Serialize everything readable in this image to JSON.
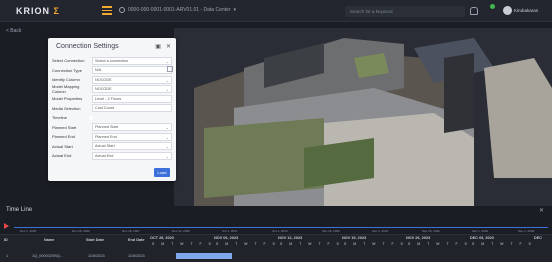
{
  "header": {
    "logo_text": "KRION",
    "logo_accent": "Σ",
    "breadcrumb": "0000-000-0001-0001-ARV01.01 - Data Center",
    "search_placeholder": "Search for a keyword",
    "username": "Kirubakaran"
  },
  "nav": {
    "back_label": "< Back"
  },
  "connection_settings": {
    "title": "Connection Settings",
    "rows": [
      {
        "label": "Select Connection",
        "value": "Select a connection"
      },
      {
        "label": "Connection Type",
        "value": "N/A"
      },
      {
        "label": "Identity Column",
        "value": "NOCODE"
      },
      {
        "label": "Model Mapping Column",
        "value": "NOCODE"
      },
      {
        "label": "Model Properties",
        "value": "Level - 2 Floors"
      },
      {
        "label": "Media Selection",
        "value": "Cost Count"
      },
      {
        "label": "Timeline",
        "value": ""
      },
      {
        "label": "Planned Start",
        "value": "Planned Start"
      },
      {
        "label": "Planned End",
        "value": "Planned End"
      },
      {
        "label": "Actual Start",
        "value": "Actual Start"
      },
      {
        "label": "Actual End",
        "value": "Actual End"
      }
    ],
    "load_label": "Load"
  },
  "timeline": {
    "title": "Time Line",
    "scale_labels": [
      "Dec 1, 2025",
      "Dec 29, 2026",
      "Dec 18, 2027",
      "Dec 12, 2030",
      "Oct 1, 2011",
      "Oct 1, 2030",
      "Sep 16, 2030",
      "Sep 1, 2031",
      "Sep 16, 2030",
      "Sep 1, 2030",
      "Sep 1, 2040"
    ],
    "columns": {
      "id": "ID",
      "name": "Name",
      "start": "Start Date",
      "end": "End Date"
    },
    "weeks": [
      "OCT 29, 2023",
      "NOV 06, 2023",
      "NOV 12, 2023",
      "NOV 19, 2023",
      "NOV 26, 2023",
      "DEC 03, 2023",
      "DEC"
    ],
    "days": "S M T W T F S",
    "rows": [
      {
        "id": "1",
        "name": "1Q_000002VBQ...",
        "start": "11/5/2023",
        "end": "11/5/2023"
      }
    ]
  }
}
